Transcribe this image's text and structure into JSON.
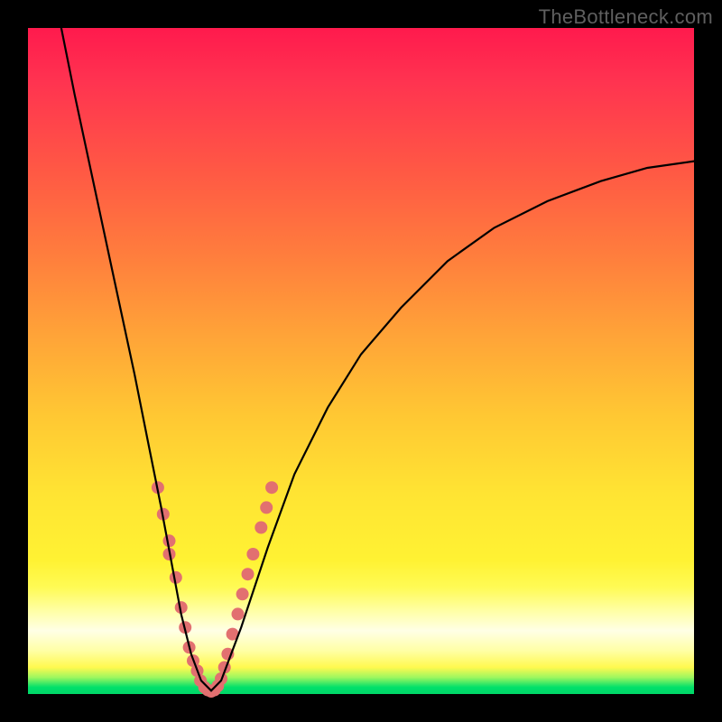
{
  "watermark": "TheBottleneck.com",
  "colors": {
    "frame": "#000000",
    "curve_stroke": "#000000",
    "marker_fill": "#e27070",
    "gradient_top": "#ff1a4d",
    "gradient_bottom": "#00d768"
  },
  "chart_data": {
    "type": "line",
    "title": "",
    "xlabel": "",
    "ylabel": "",
    "xlim": [
      0,
      100
    ],
    "ylim": [
      0,
      100
    ],
    "note": "Axes are unlabeled in the image; values are relative percentages inferred from pixel positions. y=100 at top, y=0 at bottom (green band). Single V-shaped curve with scattered salmon markers near the trough.",
    "series": [
      {
        "name": "curve",
        "x": [
          5,
          7,
          10,
          13,
          16,
          18,
          20,
          21.5,
          23,
          24.5,
          26,
          27.5,
          29,
          32,
          36,
          40,
          45,
          50,
          56,
          63,
          70,
          78,
          86,
          93,
          100
        ],
        "y": [
          100,
          90,
          76,
          62,
          48,
          38,
          28,
          20,
          12,
          6,
          2,
          0.5,
          2,
          10,
          22,
          33,
          43,
          51,
          58,
          65,
          70,
          74,
          77,
          79,
          80
        ]
      },
      {
        "name": "markers",
        "x": [
          19.5,
          20.3,
          21.2,
          21.2,
          22.2,
          23.0,
          23.6,
          24.2,
          24.8,
          25.4,
          25.9,
          26.5,
          27.0,
          27.5,
          28.0,
          28.5,
          29.0,
          29.5,
          30.0,
          30.7,
          31.5,
          32.2,
          33.0,
          33.8,
          35.0,
          35.8,
          36.6
        ],
        "y": [
          31.0,
          27.0,
          23.0,
          21.0,
          17.5,
          13.0,
          10.0,
          7.0,
          5.0,
          3.5,
          2.0,
          1.0,
          0.6,
          0.4,
          0.6,
          1.2,
          2.3,
          4.0,
          6.0,
          9.0,
          12.0,
          15.0,
          18.0,
          21.0,
          25.0,
          28.0,
          31.0
        ]
      }
    ]
  }
}
